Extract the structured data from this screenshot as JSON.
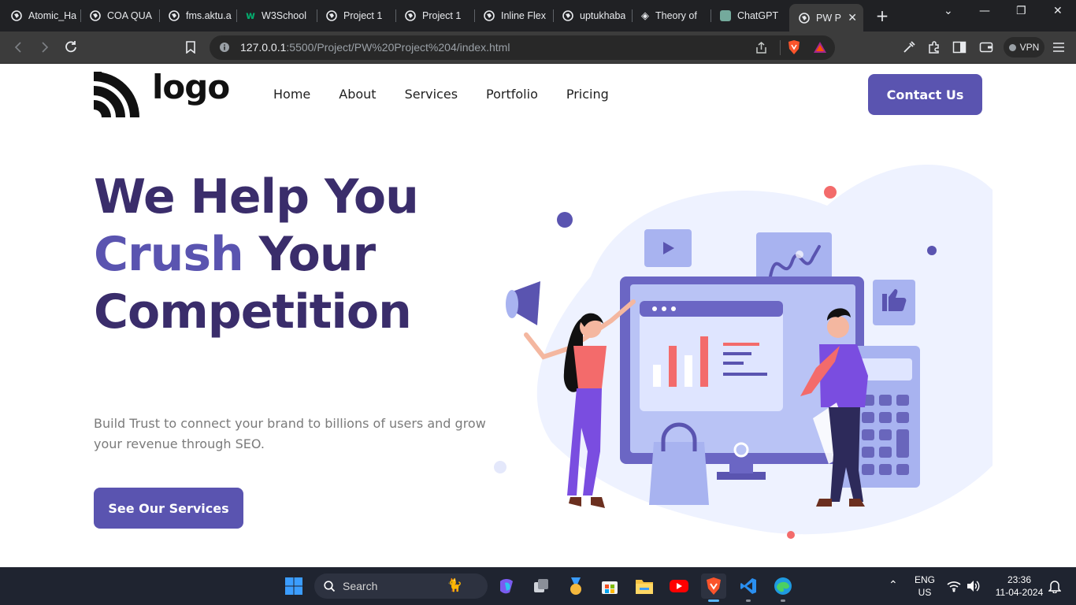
{
  "browser": {
    "tabs": [
      {
        "title": "Atomic_Ha"
      },
      {
        "title": "COA QUA"
      },
      {
        "title": "fms.aktu.a"
      },
      {
        "title": "W3School"
      },
      {
        "title": "Project 1"
      },
      {
        "title": "Project 1"
      },
      {
        "title": "Inline Flex"
      },
      {
        "title": "uptukhaba"
      },
      {
        "title": "Theory of"
      },
      {
        "title": "ChatGPT"
      },
      {
        "title": "PW P"
      }
    ],
    "url_host": "127.0.0.1",
    "url_path": ":5500/Project/PW%20Project%204/index.html",
    "vpn_label": "VPN"
  },
  "site": {
    "logo_text": "logo",
    "nav": [
      "Home",
      "About",
      "Services",
      "Portfolio",
      "Pricing"
    ],
    "contact_button": "Contact Us",
    "hero": {
      "line1": "We Help You",
      "line2_accent": "Crush",
      "line2_rest": " Your",
      "line3": "Competition",
      "description": "Build Trust to connect your brand to billions of users and grow your revenue through SEO.",
      "cta": "See Our Services"
    }
  },
  "taskbar": {
    "search_label": "Search",
    "lang_top": "ENG",
    "lang_bottom": "US",
    "time": "23:36",
    "date": "11-04-2024"
  },
  "colors": {
    "brand": "#5a54b0",
    "heading": "#3a2d6b",
    "illustration_light": "#eef2ff"
  }
}
